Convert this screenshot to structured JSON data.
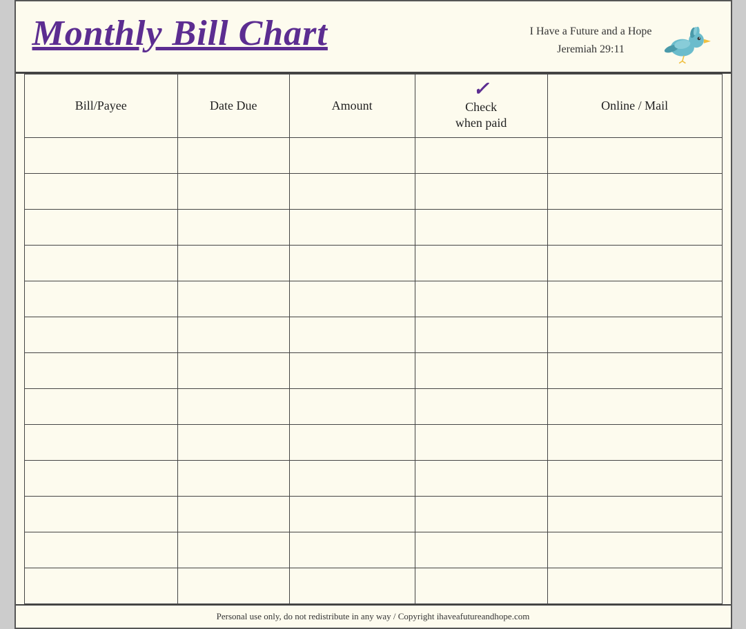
{
  "page": {
    "background_color": "#fdfbee",
    "border_color": "#444"
  },
  "header": {
    "title": "Monthly Bill Chart",
    "subtitle_line1": "I Have a Future and a Hope",
    "subtitle_line2": "Jeremiah 29:11"
  },
  "table": {
    "columns": [
      {
        "id": "bill",
        "label": "Bill/Payee"
      },
      {
        "id": "date",
        "label": "Date Due"
      },
      {
        "id": "amount",
        "label": "Amount"
      },
      {
        "id": "check",
        "label": "Check\nwhen paid",
        "check_symbol": "✓"
      },
      {
        "id": "online",
        "label": "Online / Mail"
      }
    ],
    "row_count": 13
  },
  "footer": {
    "text": "Personal use only, do not redistribute in any way / Copyright ihaveafutureandhope.com"
  }
}
